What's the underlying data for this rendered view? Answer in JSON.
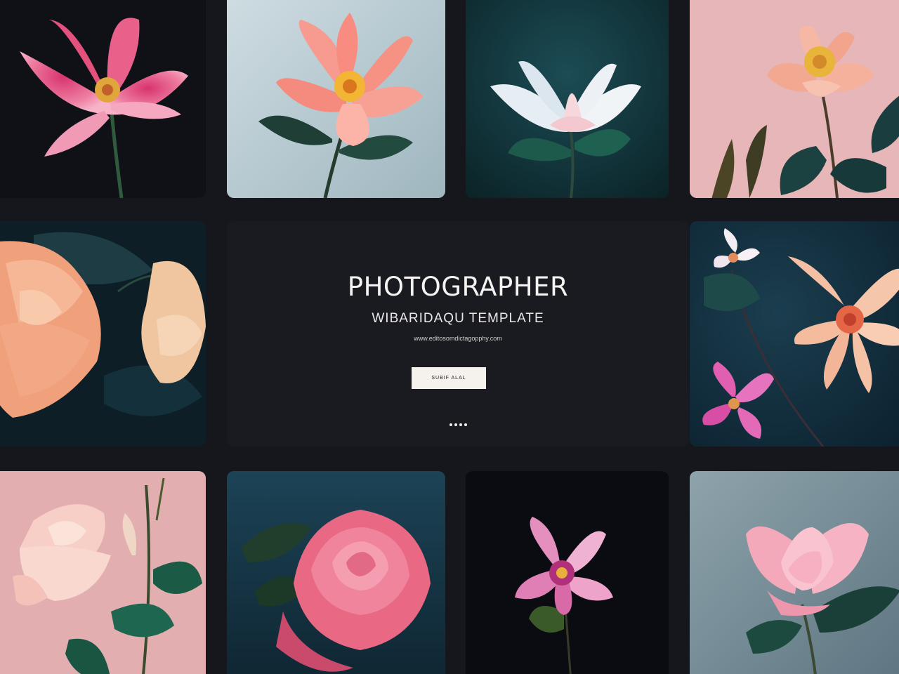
{
  "hero": {
    "eyebrow": "",
    "title": "PHOTOGRAPHER",
    "subtitle": "WIBARIDAQU TEMPLATE",
    "url": "www.editosomdictagopphy.com",
    "cta_label": "SUBIF ALAL",
    "slide_count": 4
  },
  "gallery": {
    "tiles": [
      {
        "name": "pink magnolia on black",
        "bg": "#0f1117"
      },
      {
        "name": "coral flower on pale blue",
        "bg": "#b9cbd2"
      },
      {
        "name": "white blossom on teal",
        "bg": "#123b42"
      },
      {
        "name": "peach peony on pink",
        "bg": "#e6b6b8"
      },
      {
        "name": "peach rose on dark",
        "bg": "#0e1e26"
      },
      {
        "name": "peach daisy on navy",
        "bg": "#0f2a38"
      },
      {
        "name": "light pink rose on pink",
        "bg": "#e2aeb0"
      },
      {
        "name": "pink rose on dark teal",
        "bg": "#133240"
      },
      {
        "name": "magenta blossom on black",
        "bg": "#0b0c11"
      },
      {
        "name": "pink peony on slate",
        "bg": "#718a95"
      }
    ]
  },
  "colors": {
    "page_bg": "#16171c",
    "hero_bg": "#1a1b20",
    "cta_bg": "#f5f1ec"
  }
}
